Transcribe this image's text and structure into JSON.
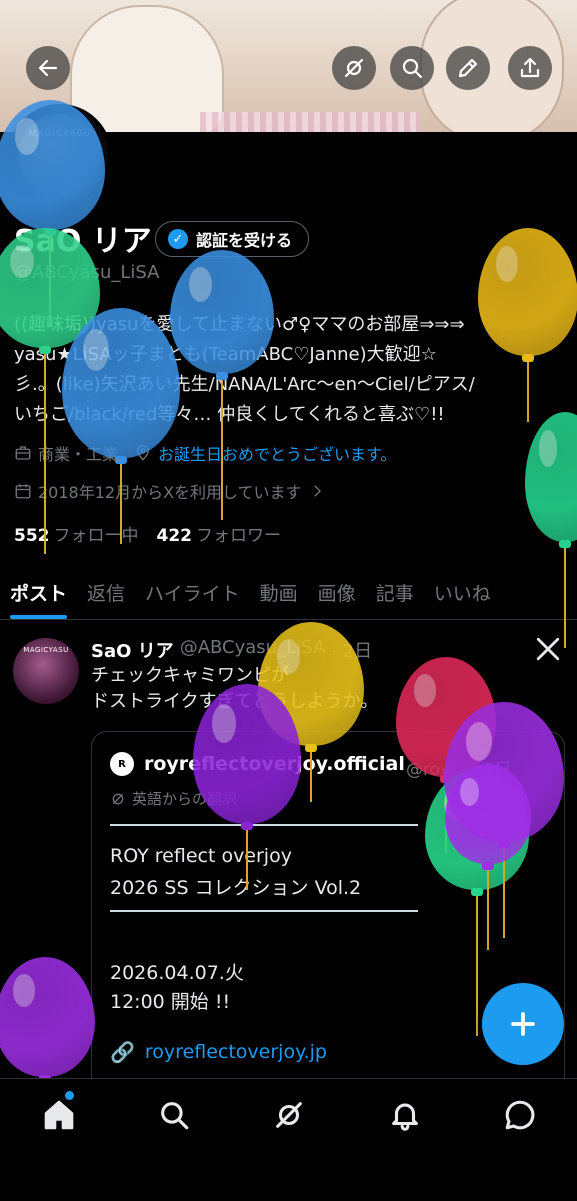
{
  "header": {
    "back_icon": "arrow-left-icon",
    "actions": [
      "grok-icon",
      "search-icon",
      "edit-icon",
      "share-icon"
    ],
    "avatar_watermark": "MAGICYASU"
  },
  "profile": {
    "name": "SaO リア",
    "verify_label": "認証を受ける",
    "handle": "@ABCyasu_LiSA",
    "bio": "((趣味垢))yasuを愛して止まない♂♀ママのお部屋⇒⇒⇒\nyasu★LiSAッ子まとも(TeamABC♡Janne)大歓迎☆\n彡.。(like)矢沢あい先生/NANA/L'Arc～en～Ciel/ピアス/\nいちご/black/red等々… 仲良くしてくれると喜ぶ♡!!",
    "category": "商業・工業",
    "birthday_text": "お誕生日おめでとうございます。",
    "joined": "2018年12月からXを利用しています",
    "following_count": "552",
    "following_label": "フォロー中",
    "followers_count": "422",
    "followers_label": "フォロワー"
  },
  "tabs": [
    "ポスト",
    "返信",
    "ハイライト",
    "動画",
    "画像",
    "記事",
    "いいね"
  ],
  "tweet": {
    "name": "SaO リア",
    "handle": "@ABCyasu_LiSA",
    "time": "· 2日",
    "avatar_watermark": "MAGICYASU",
    "text": "チェックキャミワンピが\nドストライクすぎてどうしようか。",
    "quote": {
      "name": "royreflectoverjoy.official",
      "handle": "@roy…",
      "time": "· 2日",
      "logo_text": "R",
      "translated_label": "英語からの翻訳",
      "line1": "ROY reflect overjoy",
      "line2": "2026 SS コレクション Vol.2",
      "line3": "2026.04.07.火",
      "line4": "12:00 開始 !!",
      "link": "royreflectoverjoy.jp"
    }
  },
  "colors": {
    "accent": "#1d9bf0",
    "background": "#000000",
    "muted": "#71767b"
  },
  "balloons": [
    {
      "color": "#3a8fe0"
    },
    {
      "color": "#2fd08a"
    },
    {
      "color": "#3a8fe0"
    },
    {
      "color": "#3a8fe0"
    },
    {
      "color": "#e8b818"
    },
    {
      "color": "#25d38e"
    },
    {
      "color": "#e8c21a"
    },
    {
      "color": "#8a24d6"
    },
    {
      "color": "#e02a5a"
    },
    {
      "color": "#27d68a"
    },
    {
      "color": "#9a2ee0"
    },
    {
      "color": "#a02ee6"
    },
    {
      "color": "#9a2ee0"
    }
  ]
}
